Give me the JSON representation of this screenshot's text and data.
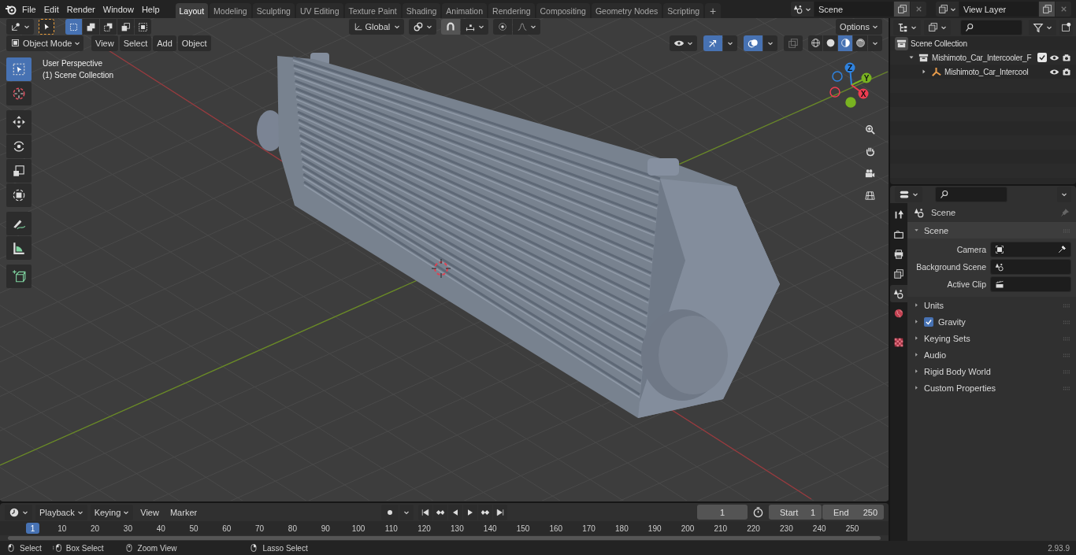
{
  "top_menu": [
    "File",
    "Edit",
    "Render",
    "Window",
    "Help"
  ],
  "workspace_tabs": [
    {
      "label": "Layout",
      "selected": true
    },
    {
      "label": "Modeling",
      "selected": false
    },
    {
      "label": "Sculpting",
      "selected": false
    },
    {
      "label": "UV Editing",
      "selected": false
    },
    {
      "label": "Texture Paint",
      "selected": false
    },
    {
      "label": "Shading",
      "selected": false
    },
    {
      "label": "Animation",
      "selected": false
    },
    {
      "label": "Rendering",
      "selected": false
    },
    {
      "label": "Compositing",
      "selected": false
    },
    {
      "label": "Geometry Nodes",
      "selected": false
    },
    {
      "label": "Scripting",
      "selected": false
    }
  ],
  "add_workspace": "+",
  "scene_field": {
    "value": "Scene"
  },
  "view_layer_field": {
    "value": "View Layer"
  },
  "viewport": {
    "selection_modes": [
      {
        "kind": "new",
        "selected": true
      },
      {
        "kind": "extend",
        "selected": false
      },
      {
        "kind": "subtract",
        "selected": false
      },
      {
        "kind": "invert",
        "selected": false
      },
      {
        "kind": "intersect",
        "selected": false
      }
    ],
    "transform_orientation": "Global",
    "options_button": "Options",
    "mode": "Object Mode",
    "menus": [
      "View",
      "Select",
      "Add",
      "Object"
    ],
    "info_lines": [
      "User Perspective",
      "(1) Scene Collection"
    ],
    "tool_groups": [
      [
        {
          "kind": "select-box",
          "selected": true
        },
        {
          "kind": "cursor",
          "selected": false
        }
      ],
      [
        {
          "kind": "move",
          "selected": false
        },
        {
          "kind": "rotate",
          "selected": false
        },
        {
          "kind": "scale",
          "selected": false
        },
        {
          "kind": "transform",
          "selected": false
        }
      ],
      [
        {
          "kind": "annotate",
          "selected": false
        },
        {
          "kind": "measure",
          "selected": false
        }
      ],
      [
        {
          "kind": "add-cube",
          "selected": false
        }
      ]
    ],
    "gizmo_axes": [
      {
        "label": "Z",
        "color": "#2f83e0"
      },
      {
        "label": "Y",
        "color": "#79b321"
      },
      {
        "label": "X",
        "color": "#ee3d51"
      }
    ],
    "shading_modes": [
      {
        "kind": "wireframe",
        "selected": false
      },
      {
        "kind": "solid",
        "selected": false
      },
      {
        "kind": "material",
        "selected": true
      },
      {
        "kind": "rendered",
        "selected": false
      }
    ]
  },
  "outliner": {
    "items": [
      {
        "label": "Scene Collection",
        "kind": "scene-collection",
        "children": [
          {
            "label": "Mishimoto_Car_Intercooler_F",
            "kind": "collection",
            "expanded": true,
            "checked": true,
            "children": [
              {
                "label": "Mishimoto_Car_Intercool",
                "kind": "empty",
                "expanded": false
              }
            ]
          }
        ]
      }
    ]
  },
  "properties": {
    "tabs": [
      {
        "kind": "tool",
        "selected": false
      },
      {
        "kind": "render",
        "selected": false
      },
      {
        "kind": "output",
        "selected": false
      },
      {
        "kind": "view-layer",
        "selected": false
      },
      {
        "kind": "scene",
        "selected": true
      },
      {
        "kind": "world",
        "selected": false
      },
      {
        "kind": "texture",
        "selected": false
      }
    ],
    "context": "Scene",
    "panel": {
      "title": "Scene",
      "expanded": true,
      "fields": [
        {
          "label": "Camera",
          "kind": "camera"
        },
        {
          "label": "Background Scene",
          "kind": "scene"
        },
        {
          "label": "Active Clip",
          "kind": "clip"
        }
      ]
    },
    "sections": [
      {
        "title": "Units",
        "kind": "plain",
        "expanded": false
      },
      {
        "title": "Gravity",
        "kind": "checkbox",
        "checked": true,
        "expanded": false
      },
      {
        "title": "Keying Sets",
        "kind": "plain",
        "expanded": false
      },
      {
        "title": "Audio",
        "kind": "plain",
        "expanded": false
      },
      {
        "title": "Rigid Body World",
        "kind": "plain",
        "expanded": false
      },
      {
        "title": "Custom Properties",
        "kind": "plain",
        "expanded": false
      }
    ]
  },
  "timeline": {
    "menus": [
      {
        "label": "Playback",
        "dropdown": true
      },
      {
        "label": "Keying",
        "dropdown": true
      },
      {
        "label": "View",
        "dropdown": false
      },
      {
        "label": "Marker",
        "dropdown": false
      }
    ],
    "current_frame": "1",
    "start": {
      "label": "Start",
      "value": "1"
    },
    "end": {
      "label": "End",
      "value": "250"
    },
    "playhead": "1",
    "ruler_labels": [
      "10",
      "20",
      "30",
      "40",
      "50",
      "60",
      "70",
      "80",
      "90",
      "100",
      "110",
      "120",
      "130",
      "140",
      "150",
      "160",
      "170",
      "180",
      "190",
      "200",
      "210",
      "220",
      "230",
      "240",
      "250"
    ]
  },
  "status_bar": {
    "hints": [
      {
        "kind": "mouse-left",
        "label": "Select"
      },
      {
        "kind": "mouse-drag",
        "label": "Box Select"
      },
      {
        "kind": "mouse-middle",
        "label": "Zoom View"
      },
      {
        "kind": "mouse-right",
        "label": "Lasso Select"
      }
    ],
    "version": "2.93.9"
  }
}
